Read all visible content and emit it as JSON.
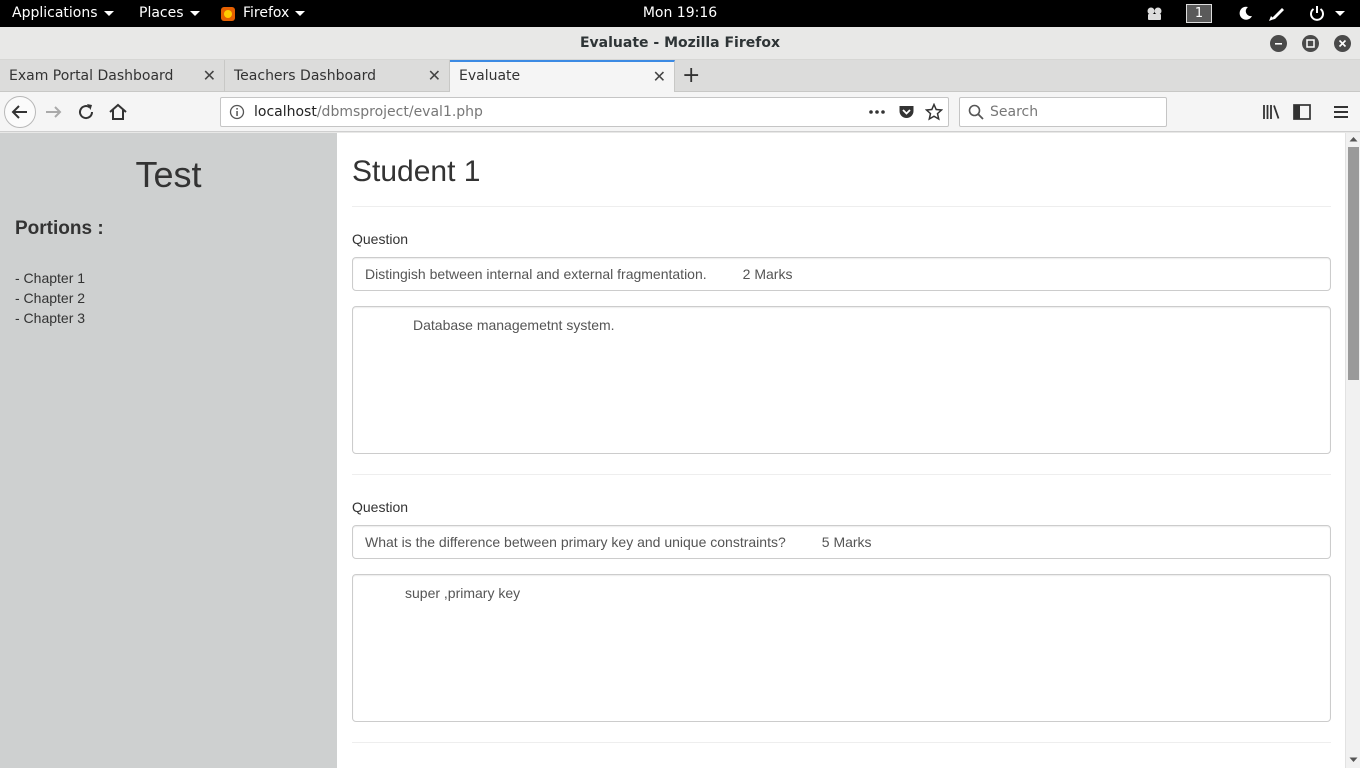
{
  "topbar": {
    "applications_label": "Applications",
    "places_label": "Places",
    "firefox_label": "Firefox",
    "clock": "Mon 19:16",
    "workspace": "1"
  },
  "window": {
    "title": "Evaluate - Mozilla Firefox"
  },
  "tabs": [
    {
      "label": "Exam Portal Dashboard"
    },
    {
      "label": "Teachers Dashboard"
    },
    {
      "label": "Evaluate"
    }
  ],
  "navbar": {
    "url_host": "localhost",
    "url_path": "/dbmsproject/eval1.php",
    "search_placeholder": "Search"
  },
  "sidebar": {
    "title": "Test",
    "portions_heading": "Portions :",
    "chapters": [
      "- Chapter 1",
      "- Chapter 2",
      "- Chapter 3"
    ]
  },
  "main": {
    "heading": "Student 1",
    "questions": [
      {
        "label": "Question",
        "text": "Distingish between internal and external fragmentation.",
        "marks": "2 Marks",
        "answer": "Database managemetnt system."
      },
      {
        "label": "Question",
        "text": "What is the difference between primary key and unique constraints?",
        "marks": "5 Marks",
        "answer": "super ,primary key"
      }
    ]
  },
  "colors": {
    "sidebar_bg": "#ced0d0",
    "active_tab_accent": "#3c8ae3"
  }
}
